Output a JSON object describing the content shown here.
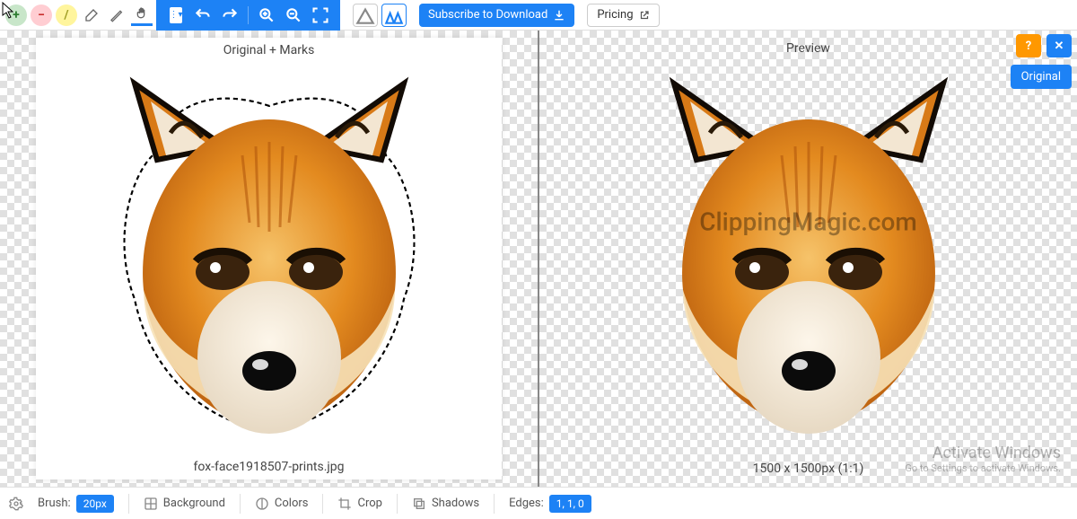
{
  "toolbar": {
    "subscribe_label": "Subscribe to Download",
    "pricing_label": "Pricing"
  },
  "panes": {
    "left_label": "Original + Marks",
    "right_label": "Preview",
    "filename": "fox-face1918507-prints.jpg",
    "dimensions": "1500 x 1500px (1:1)"
  },
  "watermark": "ClippingMagic.com",
  "float": {
    "help": "?",
    "close": "✕",
    "original": "Original"
  },
  "bottom": {
    "brush_label": "Brush:",
    "brush_value": "20px",
    "background": "Background",
    "colors": "Colors",
    "crop": "Crop",
    "shadows": "Shadows",
    "edges_label": "Edges:",
    "edges_value": "1, 1, 0"
  },
  "windows": {
    "line1": "Activate Windows",
    "line2": "Go to Settings to activate Windows."
  }
}
